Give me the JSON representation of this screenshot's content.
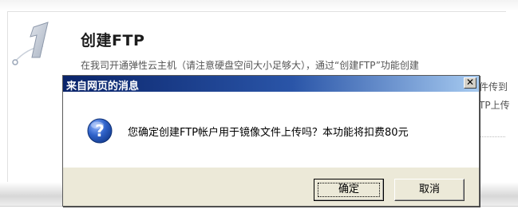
{
  "page": {
    "step_number": "1",
    "step_title": "创建FTP",
    "step_description": "在我司开通弹性云主机（请注意硬盘空间大小足够大），通过“创建FTP”功能创建",
    "step_description_line2": "件传到",
    "step_description_line3": "TP上传"
  },
  "dialog": {
    "title": "来自网页的消息",
    "close_symbol": "✕",
    "icon": "question-icon",
    "message": "您确定创建FTP帐户用于镜像文件上传吗？本功能将扣费80元",
    "ok_label": "确定",
    "cancel_label": "取消"
  },
  "colors": {
    "titlebar_start": "#0a246a",
    "titlebar_end": "#a6caf0",
    "dialog_face": "#ece9d8",
    "icon_blue": "#1f4fb0"
  }
}
